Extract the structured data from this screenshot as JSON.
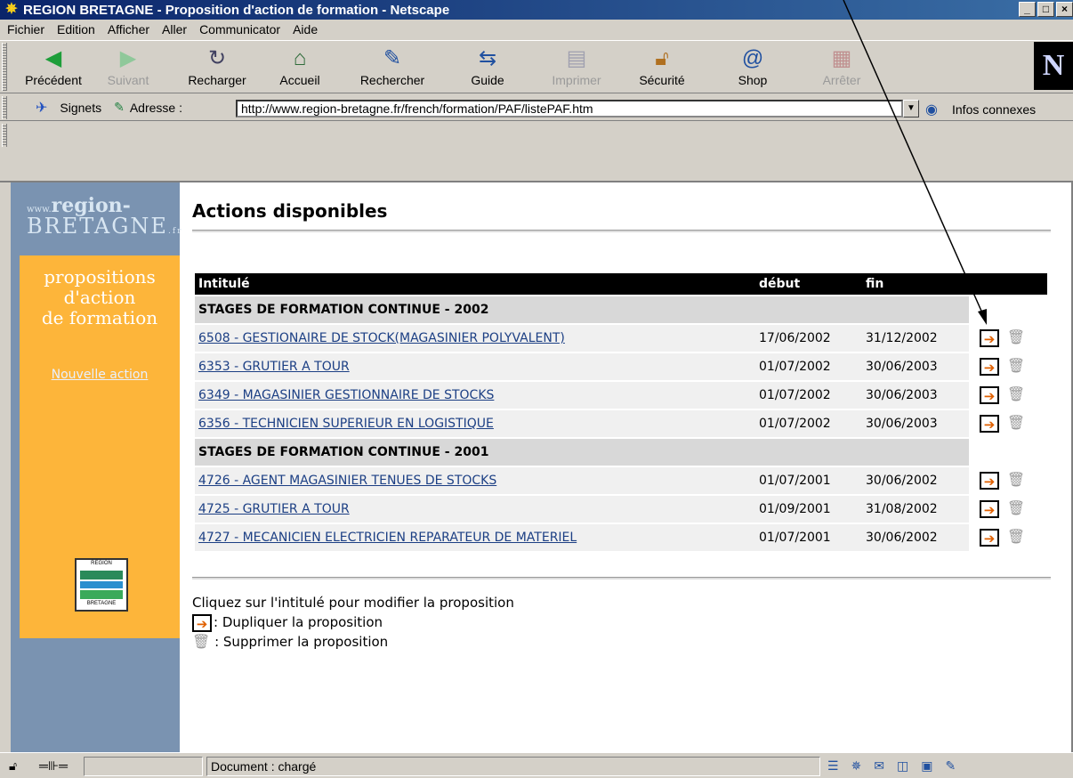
{
  "window": {
    "title": "REGION BRETAGNE - Proposition d'action de formation - Netscape",
    "buttons": [
      "_",
      "□",
      "×"
    ]
  },
  "menu": [
    "Fichier",
    "Edition",
    "Afficher",
    "Aller",
    "Communicator",
    "Aide"
  ],
  "toolbar": [
    {
      "label": "Précédent",
      "icon": "back-arrow-icon",
      "enabled": true
    },
    {
      "label": "Suivant",
      "icon": "forward-arrow-icon",
      "enabled": false
    },
    {
      "label": "Recharger",
      "icon": "reload-icon",
      "enabled": true
    },
    {
      "label": "Accueil",
      "icon": "home-icon",
      "enabled": true
    },
    {
      "label": "Rechercher",
      "icon": "search-icon",
      "enabled": true
    },
    {
      "label": "Guide",
      "icon": "guide-icon",
      "enabled": true
    },
    {
      "label": "Imprimer",
      "icon": "print-icon",
      "enabled": false
    },
    {
      "label": "Sécurité",
      "icon": "lock-icon",
      "enabled": true
    },
    {
      "label": "Shop",
      "icon": "shop-icon",
      "enabled": true
    },
    {
      "label": "Arrêter",
      "icon": "stop-icon",
      "enabled": false
    }
  ],
  "brand_logo": "N",
  "location": {
    "bookmarks": "Signets",
    "address_label": "Adresse :",
    "url": "http://www.region-bretagne.fr/french/formation/PAF/listePAF.htm",
    "related": "Infos connexes"
  },
  "sidebar": {
    "www": "www.",
    "region": "region-",
    "bretagne": "BRETAGNE",
    "fr": ".fr",
    "heading1": "propositions",
    "heading2": "d'action",
    "heading3": "de formation",
    "new_action": "Nouvelle action",
    "flag_top": "REGION",
    "flag_bottom": "BRETAGNE"
  },
  "page": {
    "title": "Actions disponibles"
  },
  "table": {
    "headers": [
      "Intitulé",
      "début",
      "fin"
    ],
    "sections": [
      {
        "label": "STAGES DE FORMATION CONTINUE - 2002",
        "rows": [
          {
            "name": "6508 - GESTIONAIRE DE STOCK(MAGASINIER POLYVALENT)",
            "start": "17/06/2002",
            "end": "31/12/2002"
          },
          {
            "name": "6353 - GRUTIER A TOUR",
            "start": "01/07/2002",
            "end": "30/06/2003"
          },
          {
            "name": "6349 - MAGASINIER GESTIONNAIRE DE STOCKS",
            "start": "01/07/2002",
            "end": "30/06/2003"
          },
          {
            "name": "6356 - TECHNICIEN SUPERIEUR EN LOGISTIQUE",
            "start": "01/07/2002",
            "end": "30/06/2003"
          }
        ]
      },
      {
        "label": "STAGES DE FORMATION CONTINUE - 2001",
        "rows": [
          {
            "name": "4726 - AGENT MAGASINIER TENUES DE STOCKS",
            "start": "01/07/2001",
            "end": "30/06/2002"
          },
          {
            "name": "4725 - GRUTIER A TOUR",
            "start": "01/09/2001",
            "end": "31/08/2002"
          },
          {
            "name": "4727 - MECANICIEN ELECTRICIEN REPARATEUR DE MATERIEL",
            "start": "01/07/2001",
            "end": "30/06/2002"
          }
        ]
      }
    ]
  },
  "legend": {
    "instruction": "Cliquez sur l'intitulé pour modifier la proposition",
    "duplicate": ": Dupliquer la proposition",
    "delete": ": Supprimer la proposition"
  },
  "status": {
    "text": "Document : chargé"
  }
}
